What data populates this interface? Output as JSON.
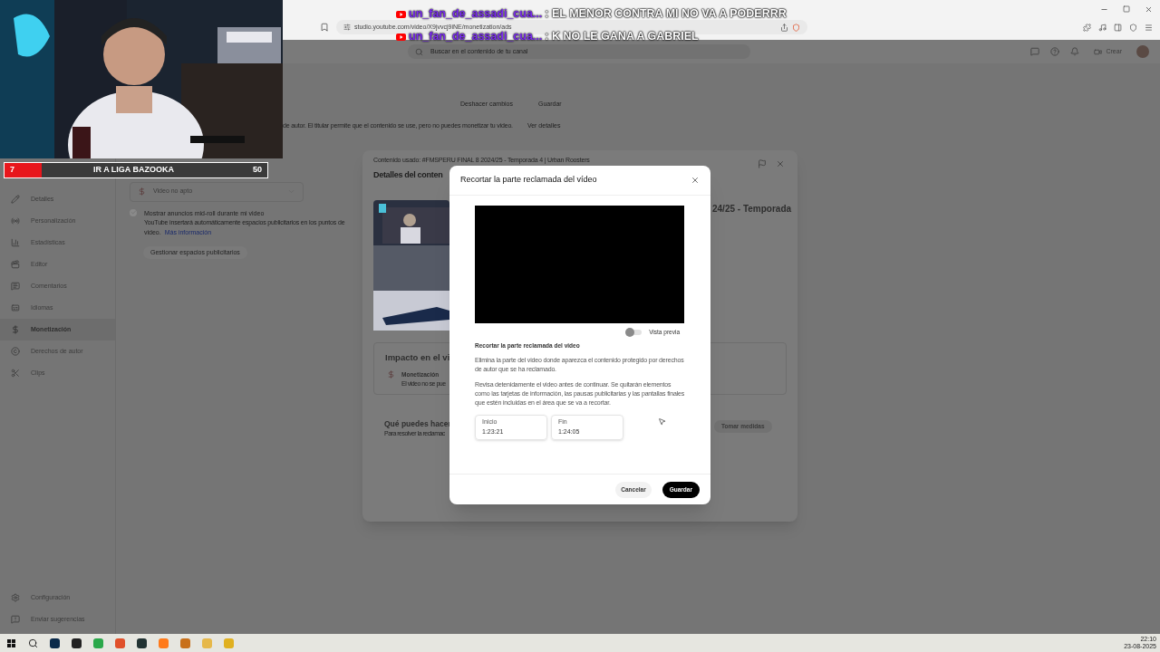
{
  "browser": {
    "url": "studio.youtube.com/video/X9jvvcj9iNE/monetization/ads"
  },
  "chat": [
    {
      "author": "un_fan_de_assadi_cua...",
      "message": ": EL MENOR CONTRA MI NO VA A PODERRR"
    },
    {
      "author": "un_fan_de_assadi_cua...",
      "message": ": K NO LE GANA A GABRIEL"
    }
  ],
  "studio_header": {
    "search_placeholder": "Buscar en el contenido de tu canal",
    "create_button": "Crear"
  },
  "goal_bar": {
    "current": "7",
    "title": "IR A LIGA BAZOOKA",
    "target": "50",
    "level": 0.14
  },
  "sidebar": {
    "items": [
      {
        "label": "Detalles",
        "selected": false
      },
      {
        "label": "Personalización",
        "selected": false
      },
      {
        "label": "Estadísticas",
        "selected": false
      },
      {
        "label": "Editor",
        "selected": false
      },
      {
        "label": "Comentarios",
        "selected": false
      },
      {
        "label": "Idiomas",
        "selected": false
      },
      {
        "label": "Monetización",
        "selected": true
      },
      {
        "label": "Derechos de autor",
        "selected": false
      },
      {
        "label": "Clips",
        "selected": false
      }
    ],
    "footer_items": [
      "Configuración",
      "Enviar sugerencias"
    ]
  },
  "page": {
    "actions": [
      "Deshacer cambios",
      "Guardar"
    ],
    "notice": "de autor. El titular permite que el contenido se use, pero no puedes monetizar tu video.",
    "notice_link": "Ver detalles",
    "monetization_value": "Video no apto",
    "midroll": {
      "label": "Mostrar anuncios mid-roll durante mi video",
      "checked": true,
      "description": "YouTube insertará automáticamente espacios publicitarios en los puntos de",
      "description_end": "video.",
      "link": "Más información"
    },
    "manage_button": "Gestionar espacios publicitarios"
  },
  "content_details": {
    "used_content": "Contenido usado: #FMSPERU FINAL 8 2024/25 - Temporada 4 | Urban Roosters",
    "title": "Detalles del conten",
    "video_title": "24/25 - Temporada",
    "impact": {
      "title": "Impacto en el vi",
      "item": "Monetización",
      "item_description": "El video no se pue"
    },
    "actions": {
      "title": "Qué puedes hacer",
      "description": "Para resolver la reclamac",
      "button": "Tomar medidas"
    }
  },
  "trim_dialog": {
    "title": "Recortar la parte reclamada del vídeo",
    "preview": {
      "label": "Vista previa",
      "on": false
    },
    "heading": "Recortar la parte reclamada del video",
    "paragraphs": [
      "Elimina la parte del video donde aparezca el contenido protegido por derechos de autor que se ha reclamado.",
      "Revisa detenidamente el video antes de continuar. Se quitarán elementos como las tarjetas de información, las pausas publicitarias y las pantallas finales que estén incluidas en el área que se va a recortar."
    ],
    "fields": [
      {
        "label": "Inicio",
        "value": "1:23:21"
      },
      {
        "label": "Fin",
        "value": "1:24:05"
      }
    ],
    "buttons": {
      "cancel": "Cancelar",
      "save": "Guardar"
    }
  },
  "taskbar": {
    "time": "22:10",
    "date": "23-08-2025"
  }
}
